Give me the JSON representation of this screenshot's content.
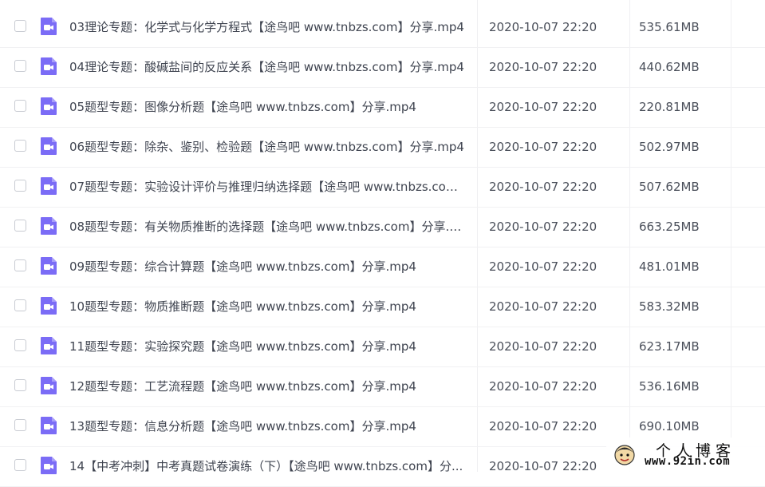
{
  "files": [
    {
      "name": "03理论专题：化学式与化学方程式【途鸟吧 www.tnbzs.com】分享.mp4",
      "date": "2020-10-07 22:20",
      "size": "535.61MB"
    },
    {
      "name": "04理论专题：酸碱盐间的反应关系【途鸟吧 www.tnbzs.com】分享.mp4",
      "date": "2020-10-07 22:20",
      "size": "440.62MB"
    },
    {
      "name": "05题型专题：图像分析题【途鸟吧 www.tnbzs.com】分享.mp4",
      "date": "2020-10-07 22:20",
      "size": "220.81MB"
    },
    {
      "name": "06题型专题：除杂、鉴别、检验题【途鸟吧 www.tnbzs.com】分享.mp4",
      "date": "2020-10-07 22:20",
      "size": "502.97MB"
    },
    {
      "name": "07题型专题：实验设计评价与推理归纳选择题【途鸟吧 www.tnbzs.com...",
      "date": "2020-10-07 22:20",
      "size": "507.62MB"
    },
    {
      "name": "08题型专题：有关物质推断的选择题【途鸟吧 www.tnbzs.com】分享.m...",
      "date": "2020-10-07 22:20",
      "size": "663.25MB"
    },
    {
      "name": "09题型专题：综合计算题【途鸟吧 www.tnbzs.com】分享.mp4",
      "date": "2020-10-07 22:20",
      "size": "481.01MB"
    },
    {
      "name": "10题型专题：物质推断题【途鸟吧 www.tnbzs.com】分享.mp4",
      "date": "2020-10-07 22:20",
      "size": "583.32MB"
    },
    {
      "name": "11题型专题：实验探究题【途鸟吧 www.tnbzs.com】分享.mp4",
      "date": "2020-10-07 22:20",
      "size": "623.17MB"
    },
    {
      "name": "12题型专题：工艺流程题【途鸟吧 www.tnbzs.com】分享.mp4",
      "date": "2020-10-07 22:20",
      "size": "536.16MB"
    },
    {
      "name": "13题型专题：信息分析题【途鸟吧 www.tnbzs.com】分享.mp4",
      "date": "2020-10-07 22:20",
      "size": "690.10MB"
    },
    {
      "name": "14【中考冲刺】中考真题试卷演练（下）【途鸟吧 www.tnbzs.com】分...",
      "date": "2020-10-07 22:20",
      "size": ""
    }
  ],
  "file_icon": {
    "name": "video-file-icon",
    "color": "#7b6cf6"
  },
  "watermark": {
    "title": "个人博客",
    "url": "www.92in.com"
  }
}
